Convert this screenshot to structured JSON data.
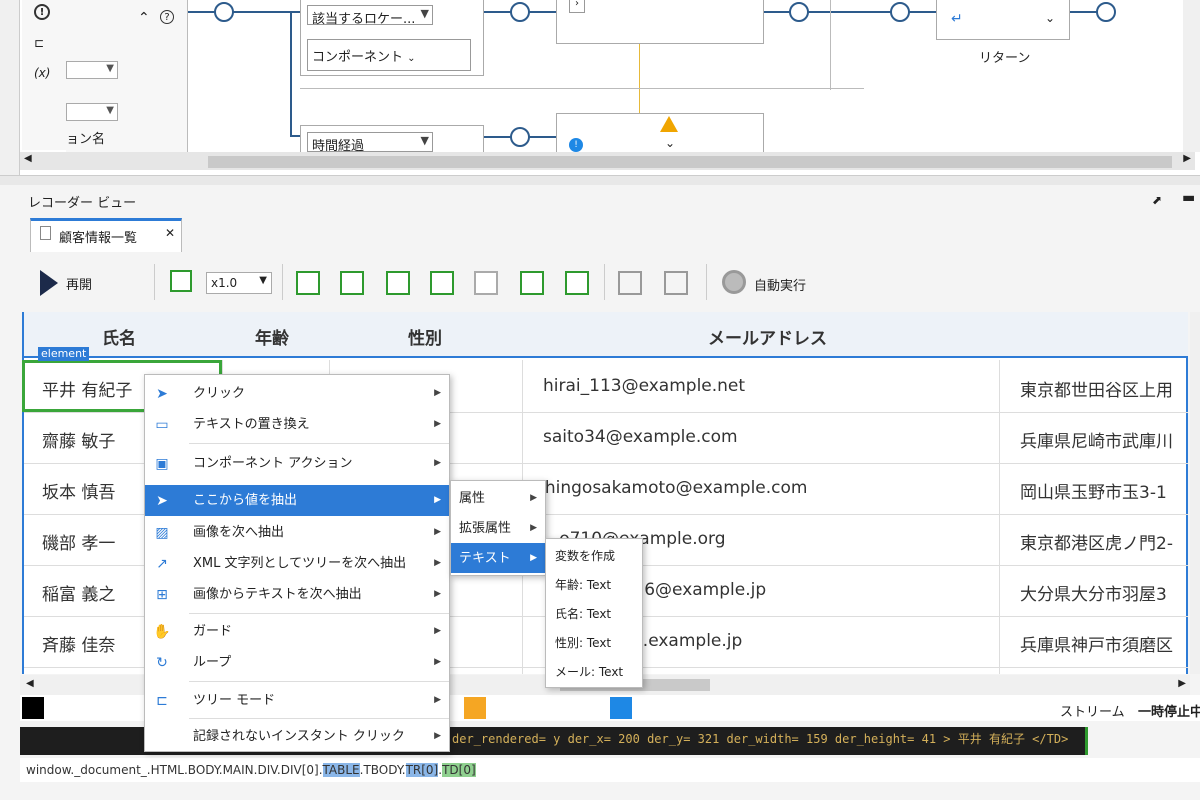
{
  "flow": {
    "props_label": "ョン名",
    "locator_select": "該当するロケー...",
    "component_select": "コンポーネント",
    "time_select": "時間経過",
    "return_select": "↵",
    "return_label": "リターン",
    "jump_icon_text": "⌃"
  },
  "recorder": {
    "title": "レコーダー ビュー",
    "tab_label": "顧客情報一覧",
    "tab_close": "✕",
    "resume_label": "再開",
    "speed_value": "x1.0",
    "auto_run_label": "自動実行"
  },
  "table": {
    "headers": [
      "氏名",
      "年齢",
      "性別",
      "メールアドレス"
    ],
    "rows": [
      {
        "name": "平井 有紀子",
        "email": "hirai_113@example.net",
        "address": "東京都世田谷区上用"
      },
      {
        "name": "齋藤 敏子",
        "email": "saito34@example.com",
        "address": "兵庫県尼崎市武庫川"
      },
      {
        "name": "坂本 慎吾",
        "email": "shingosakamoto@example.com",
        "address": "岡山県玉野市玉3-1"
      },
      {
        "name": "磯部 孝一",
        "email": "...o710@example.org",
        "address": "東京都港区虎ノ門2-"
      },
      {
        "name": "稲富 義之",
        "email": "...6@example.jp",
        "address": "大分県大分市羽屋3"
      },
      {
        "name": "斉藤 佳奈",
        "email": "...example.jp",
        "address": "兵庫県神戸市須磨区"
      }
    ],
    "element_label": "element"
  },
  "context_menu": {
    "items": [
      {
        "label": "クリック",
        "icon": "cursor-icon"
      },
      {
        "label": "テキストの置き換え",
        "icon": "text-replace-icon"
      },
      {
        "label": "コンポーネント アクション",
        "icon": "component-icon"
      },
      {
        "label": "ここから値を抽出",
        "icon": "extract-icon"
      },
      {
        "label": "画像を次へ抽出",
        "icon": "image-icon"
      },
      {
        "label": "XML 文字列としてツリーを次へ抽出",
        "icon": "share-icon"
      },
      {
        "label": "画像からテキストを次へ抽出",
        "icon": "ocr-icon"
      },
      {
        "label": "ガード",
        "icon": "hand-icon"
      },
      {
        "label": "ループ",
        "icon": "loop-icon"
      },
      {
        "label": "ツリー モード",
        "icon": "tree-icon"
      },
      {
        "label": "記録されないインスタント クリック",
        "icon": "none"
      }
    ]
  },
  "submenu1": {
    "items": [
      "属性",
      "拡張属性",
      "テキスト"
    ]
  },
  "submenu2": {
    "items": [
      "変数を作成",
      "年齢: Text",
      "氏名: Text",
      "性別: Text",
      "メール: Text"
    ]
  },
  "bottom": {
    "stream_label": "ストリーム",
    "pause_label": "一時停止中",
    "code_text": "der_rendered= y der_x= 200 der_y= 321 der_width= 159 der_height= 41 > 平井 有紀子 </TD>",
    "path_prefix": "window._document_.HTML.BODY.MAIN.DIV.DIV[0].",
    "path_table": "TABLE",
    "path_tbody": ".TBODY.",
    "path_tr": "TR[0]",
    "path_dot": ".",
    "path_td": "TD[0]"
  },
  "colors": {
    "accent": "#2d7bd6",
    "green": "#2e9a2e",
    "orange": "#f5a623",
    "blue_swatch": "#1e88e5"
  }
}
